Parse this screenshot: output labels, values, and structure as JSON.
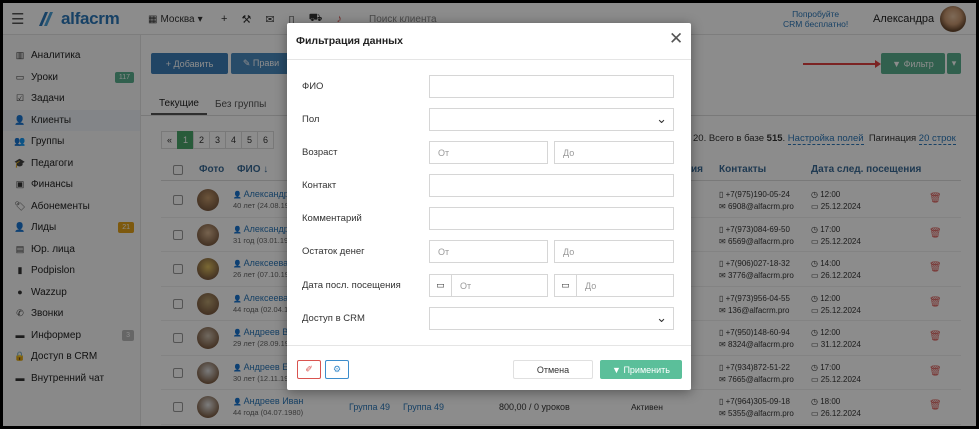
{
  "topbar": {
    "logo_text": "alfacrm",
    "city": "Москва",
    "search_placeholder": "Поиск клиента",
    "promo_line1": "Попробуйте",
    "promo_line2": "CRM бесплатно!",
    "user_name": "Александра"
  },
  "sidebar": {
    "items": [
      {
        "label": "Аналитика",
        "icon": "▥"
      },
      {
        "label": "Уроки",
        "icon": "▭",
        "badge": "117",
        "badge_color": "#5ab08e"
      },
      {
        "label": "Задачи",
        "icon": "☑"
      },
      {
        "label": "Клиенты",
        "icon": "👤"
      },
      {
        "label": "Группы",
        "icon": "👥"
      },
      {
        "label": "Педагоги",
        "icon": "🎓"
      },
      {
        "label": "Финансы",
        "icon": "▣"
      },
      {
        "label": "Абонементы",
        "icon": "🏷"
      },
      {
        "label": "Лиды",
        "icon": "👤",
        "badge": "21",
        "badge_color": "#e3a21a"
      },
      {
        "label": "Юр. лица",
        "icon": "▤"
      },
      {
        "label": "Podpislon",
        "icon": "▮"
      },
      {
        "label": "Wazzup",
        "icon": "●"
      },
      {
        "label": "Звонки",
        "icon": "✆"
      },
      {
        "label": "Информер",
        "icon": "▬",
        "badge": "3",
        "badge_color": "#bbbbbb"
      },
      {
        "label": "Доступ в CRM",
        "icon": "🔒"
      },
      {
        "label": "Внутренний чат",
        "icon": "▬"
      }
    ]
  },
  "toolbar": {
    "add_label": "+ Добавить",
    "edit_label": "✎ Прави",
    "filter_label": "▼ Фильтр"
  },
  "tabs": [
    {
      "label": "Текущие"
    },
    {
      "label": "Без группы"
    }
  ],
  "pagination": {
    "pages": [
      "«",
      "1",
      "2",
      "3",
      "4",
      "5",
      "6"
    ],
    "info_prefix": "20. Всего в базе",
    "total": "515",
    "settings_link": "Настройка полей",
    "pagination_label": "Пагинация",
    "per_page_link": "20 строк"
  },
  "table": {
    "headers": {
      "photo": "Фото",
      "fio": "ФИО ↓",
      "status": "ия",
      "contacts": "Контакты",
      "next_visit": "Дата след. посещения"
    },
    "rows": [
      {
        "name": "Александр",
        "age": "40 лет (24.08.19",
        "phone": "+7(975)190-05-24",
        "email": "6908@alfacrm.pro",
        "time": "12:00",
        "date": "25.12.2024"
      },
      {
        "name": "Александр",
        "age": "31 год (03.01.19",
        "phone": "+7(973)084-69-50",
        "email": "6569@alfacrm.pro",
        "time": "17:00",
        "date": "25.12.2024"
      },
      {
        "name": "Алексеева",
        "age": "26 лет (07.10.19",
        "phone": "+7(906)027-18-32",
        "email": "3776@alfacrm.pro",
        "time": "14:00",
        "date": "26.12.2024"
      },
      {
        "name": "Алексеева",
        "age": "44 года (02.04.1",
        "phone": "+7(973)956-04-55",
        "email": "136@alfacrm.pro",
        "time": "12:00",
        "date": "25.12.2024"
      },
      {
        "name": "Андреев Ви",
        "age": "29 лет (28.09.19",
        "phone": "+7(950)148-60-94",
        "email": "8324@alfacrm.pro",
        "time": "12:00",
        "date": "31.12.2024"
      },
      {
        "name": "Андреев Ев",
        "age": "30 лет (12.11.19",
        "phone": "+7(934)872-51-22",
        "email": "7665@alfacrm.pro",
        "time": "17:00",
        "date": "25.12.2024"
      },
      {
        "name": "Андреев Иван",
        "age": "44 года (04.07.1980)",
        "group1": "Группа 49",
        "group2": "Группа 49",
        "balance": "800,00 / 0 уроков",
        "status": "Активен",
        "phone": "+7(964)305-09-18",
        "email": "5355@alfacrm.pro",
        "time": "18:00",
        "date": "26.12.2024"
      }
    ]
  },
  "modal": {
    "title": "Фильтрация данных",
    "fields": {
      "fio": "ФИО",
      "gender": "Пол",
      "age": "Возраст",
      "contact": "Контакт",
      "comment": "Комментарий",
      "balance": "Остаток денег",
      "last_visit": "Дата посл. посещения",
      "crm_access": "Доступ в CRM"
    },
    "from_placeholder": "От",
    "to_placeholder": "До",
    "cancel_label": "Отмена",
    "apply_label": "▼ Применить"
  }
}
